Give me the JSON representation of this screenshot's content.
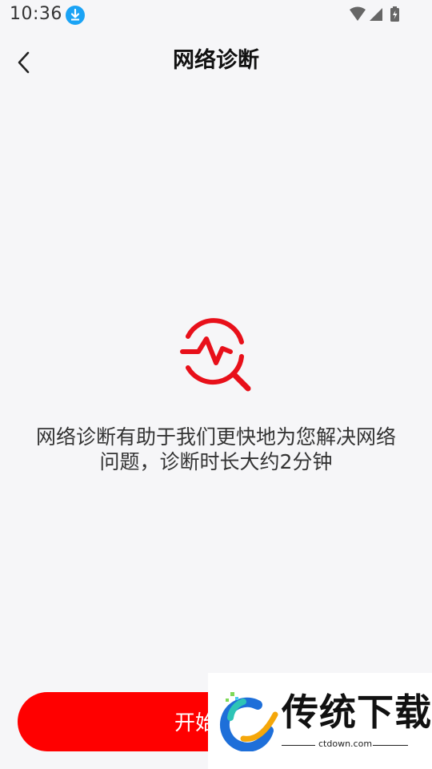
{
  "status_bar": {
    "time": "10:36",
    "icons": [
      "download-icon",
      "wifi-icon",
      "cell-signal-icon",
      "battery-charging-icon"
    ]
  },
  "nav": {
    "back_icon": "chevron-left-icon",
    "title": "网络诊断"
  },
  "main": {
    "icon": "diagnosis-magnifier-icon",
    "description": "网络诊断有助于我们更快地为您解决网络问题，诊断时长大约2分钟"
  },
  "start_button": {
    "label": "开始诊断"
  },
  "watermark": {
    "title": "传统下载",
    "url": "ctdown.com"
  },
  "colors": {
    "accent": "#ff0000",
    "background": "#f6f6f8",
    "download_badge": "#1aa3f5"
  }
}
